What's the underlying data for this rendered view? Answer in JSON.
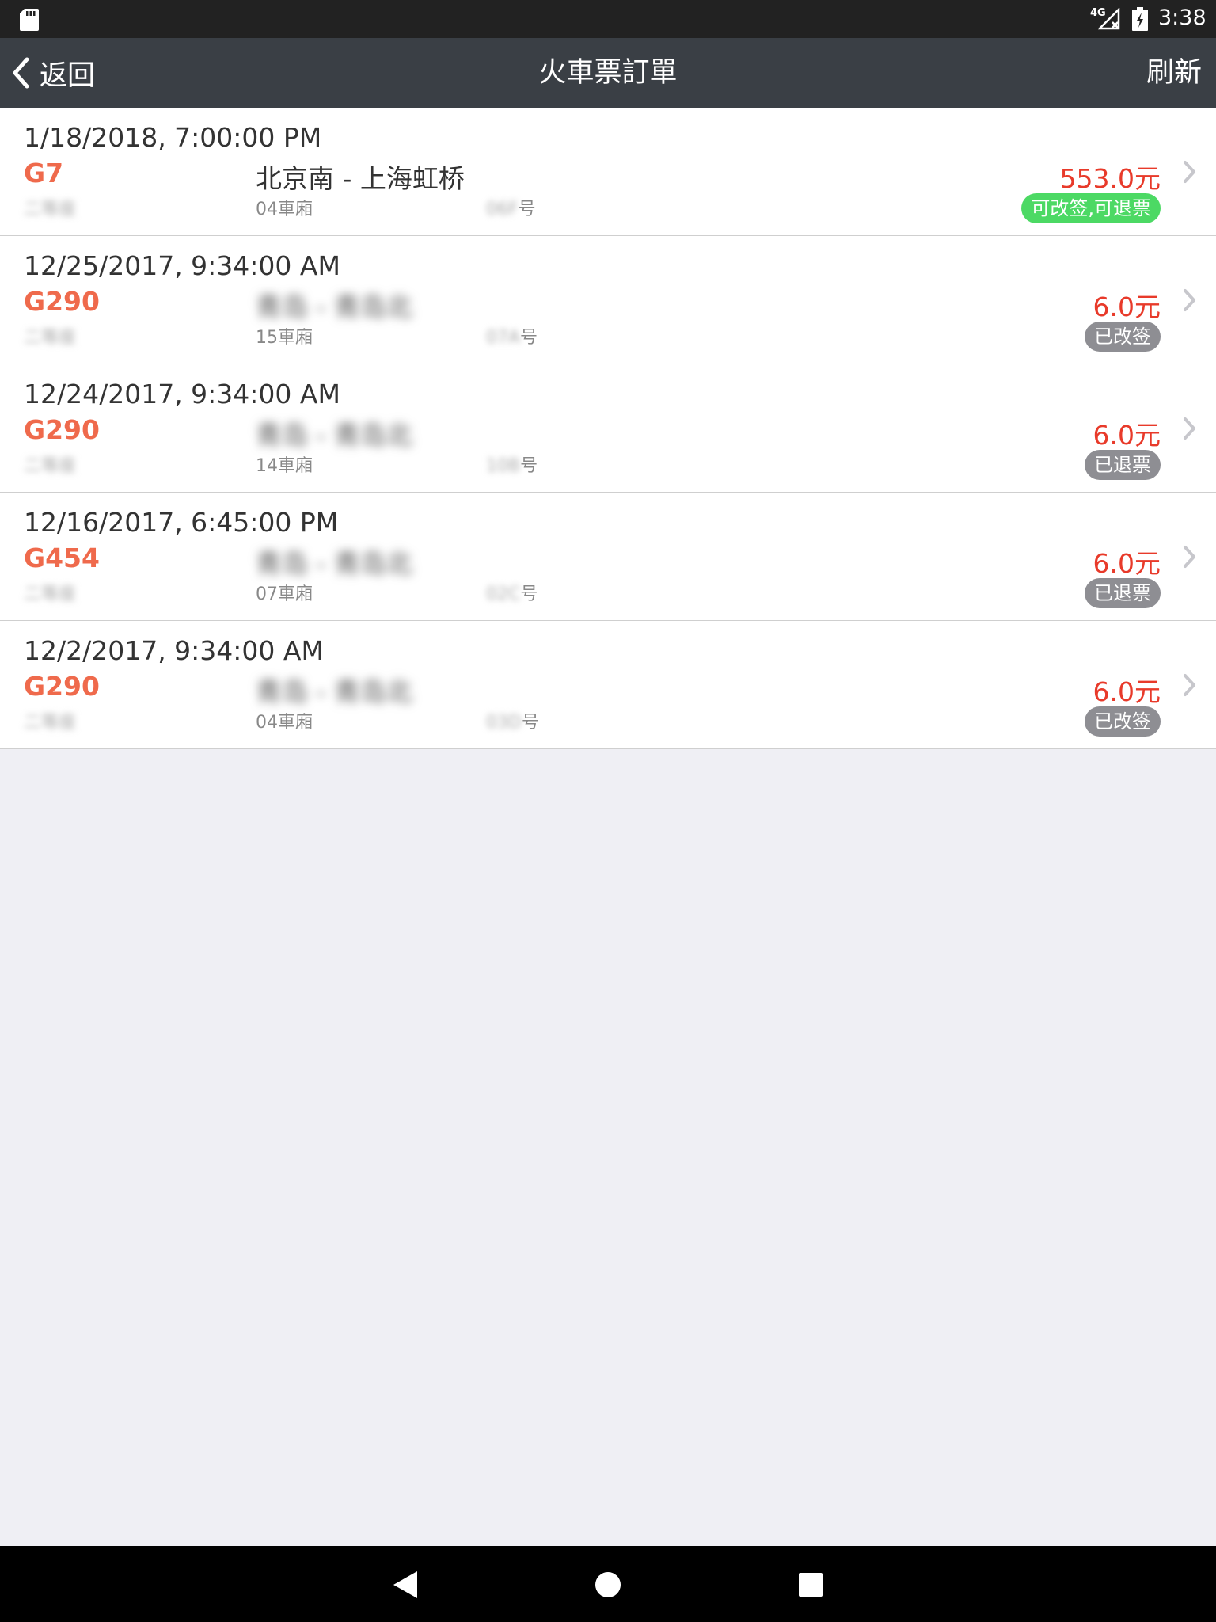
{
  "status_bar": {
    "network_label": "4G",
    "time": "3:38",
    "icons": [
      "sd-card-icon",
      "signal-icon",
      "battery-icon"
    ]
  },
  "nav": {
    "back_label": "返回",
    "title": "火車票訂單",
    "refresh_label": "刷新"
  },
  "colors": {
    "train_number": "#ef6a4c",
    "price": "#e83a2a",
    "status_active": "#4cd964",
    "status_inactive": "#8e8e93",
    "nav_bg": "#3a3f45"
  },
  "orders": [
    {
      "date": "1/18/2018, 7:00:00 PM",
      "train": "G7",
      "route": "北京南 - 上海虹桥",
      "route_blurred": false,
      "seat_type": "二等座",
      "car": "04車廂",
      "seat_no": "06F",
      "seat_suffix": "号",
      "price": "553.0元",
      "status": "可改签,可退票",
      "status_color": "#4cd964"
    },
    {
      "date": "12/25/2017, 9:34:00 AM",
      "train": "G290",
      "route": "青岛 - 青岛北",
      "route_blurred": true,
      "seat_type": "二等座",
      "car": "15車廂",
      "seat_no": "07A",
      "seat_suffix": "号",
      "price": "6.0元",
      "status": "已改签",
      "status_color": "#8e8e93"
    },
    {
      "date": "12/24/2017, 9:34:00 AM",
      "train": "G290",
      "route": "青岛 - 青岛北",
      "route_blurred": true,
      "seat_type": "二等座",
      "car": "14車廂",
      "seat_no": "10B",
      "seat_suffix": "号",
      "price": "6.0元",
      "status": "已退票",
      "status_color": "#8e8e93"
    },
    {
      "date": "12/16/2017, 6:45:00 PM",
      "train": "G454",
      "route": "青岛 - 青岛北",
      "route_blurred": true,
      "seat_type": "二等座",
      "car": "07車廂",
      "seat_no": "02C",
      "seat_suffix": "号",
      "price": "6.0元",
      "status": "已退票",
      "status_color": "#8e8e93"
    },
    {
      "date": "12/2/2017, 9:34:00 AM",
      "train": "G290",
      "route": "青岛 - 青岛北",
      "route_blurred": true,
      "seat_type": "二等座",
      "car": "04車廂",
      "seat_no": "03D",
      "seat_suffix": "号",
      "price": "6.0元",
      "status": "已改签",
      "status_color": "#8e8e93"
    }
  ],
  "system_nav": {
    "icons": [
      "back-triangle-icon",
      "home-circle-icon",
      "recent-apps-square-icon"
    ]
  }
}
